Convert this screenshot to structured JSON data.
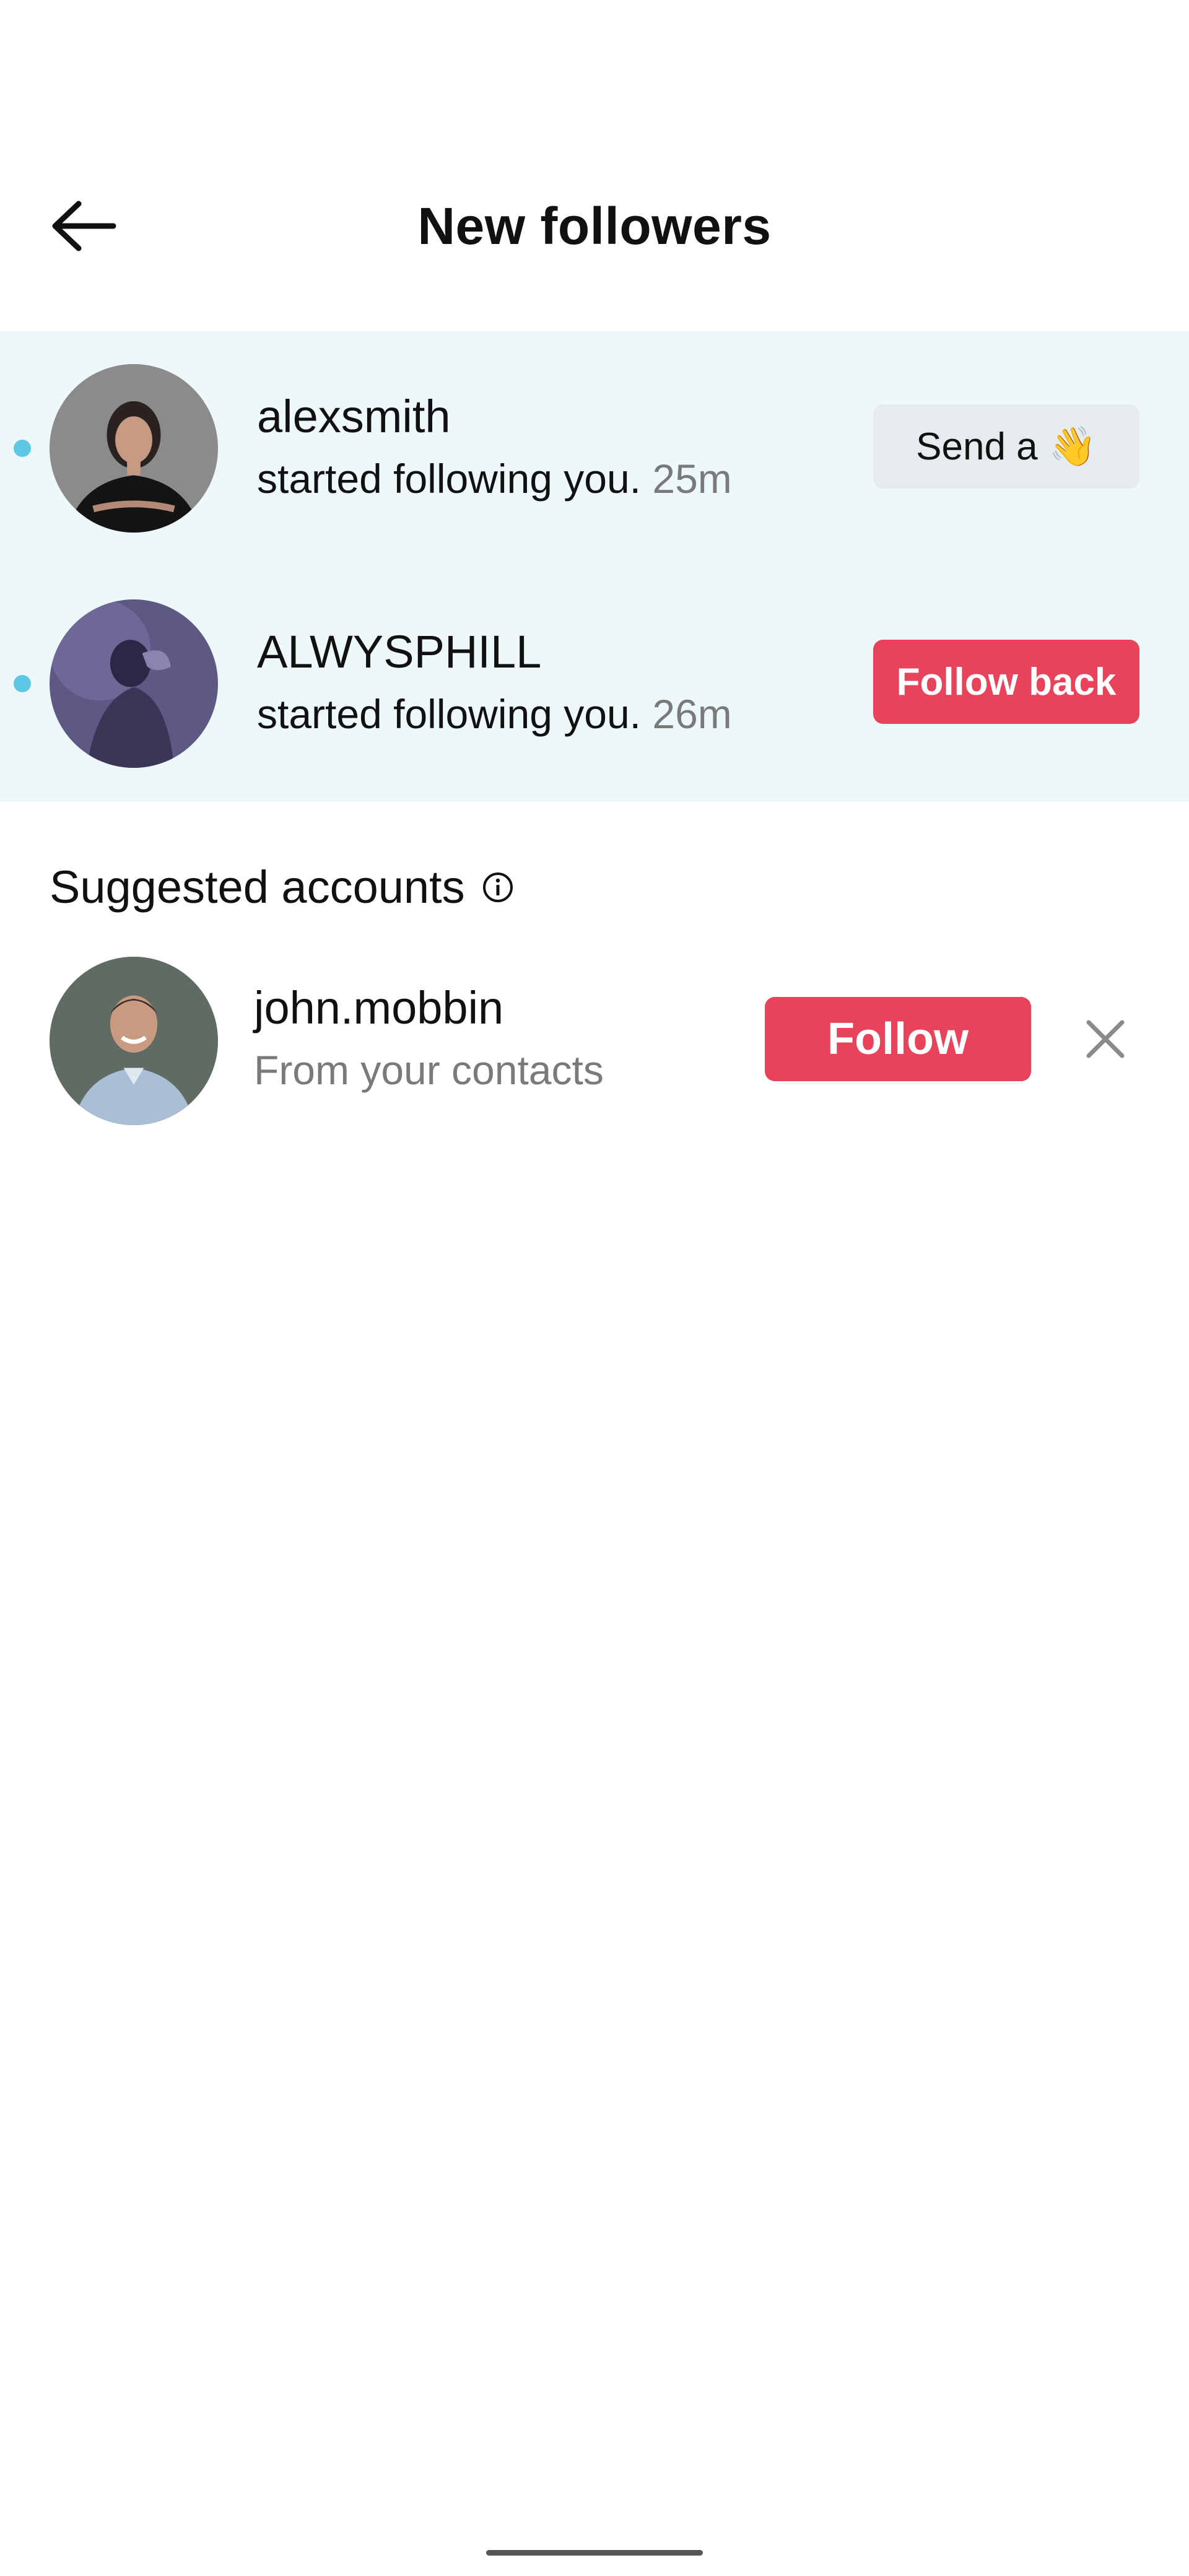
{
  "header": {
    "title": "New followers",
    "back_icon": "arrow-left-icon"
  },
  "followers": [
    {
      "username": "alexsmith",
      "action_text": "started following you.",
      "time": "25m",
      "unread": true,
      "button_label": "Send a",
      "button_emoji": "👋"
    },
    {
      "username": "ALWYSPHILL",
      "action_text": "started following you.",
      "time": "26m",
      "unread": true,
      "button_label": "Follow back"
    }
  ],
  "suggested": {
    "title": "Suggested accounts",
    "info_icon": "info-circle-icon",
    "accounts": [
      {
        "username": "john.mobbin",
        "subtitle": "From your contacts",
        "button_label": "Follow",
        "dismiss_icon": "close-icon"
      }
    ]
  },
  "colors": {
    "accent": "#e8435a",
    "highlight_bg": "#eef8fb",
    "unread_dot": "#5cc8e4",
    "secondary_button": "#e6ecee",
    "muted_text": "#7a7a7a"
  }
}
